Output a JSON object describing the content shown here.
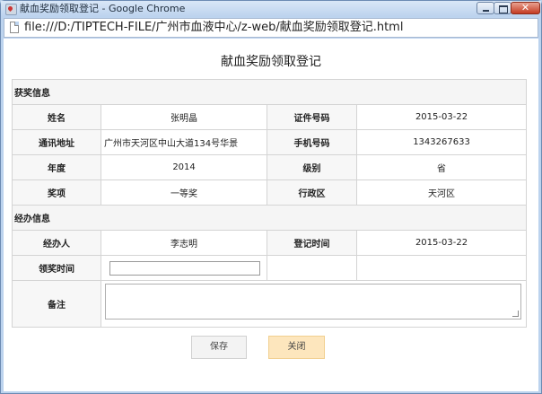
{
  "window": {
    "title": "献血奖励领取登记 - Google Chrome"
  },
  "address": {
    "url": "file:///D:/TIPTECH-FILE/广州市血液中心/z-web/献血奖励领取登记.html"
  },
  "page": {
    "title": "献血奖励领取登记"
  },
  "sections": {
    "award": "获奖信息",
    "handling": "经办信息"
  },
  "award": {
    "name_label": "姓名",
    "name": "张明晶",
    "id_label": "证件号码",
    "id": "2015-03-22",
    "address_label": "通讯地址",
    "address": "广州市天河区中山大道134号华景",
    "phone_label": "手机号码",
    "phone": "1343267633",
    "year_label": "年度",
    "year": "2014",
    "level_label": "级别",
    "level": "省",
    "prize_label": "奖项",
    "prize": "一等奖",
    "district_label": "行政区",
    "district": "天河区"
  },
  "handling": {
    "handler_label": "经办人",
    "handler": "李志明",
    "regtime_label": "登记时间",
    "regtime": "2015-03-22",
    "collect_label": "领奖时间",
    "collect_value": "",
    "remark_label": "备注",
    "remark": ""
  },
  "buttons": {
    "save": "保存",
    "close": "关闭"
  }
}
